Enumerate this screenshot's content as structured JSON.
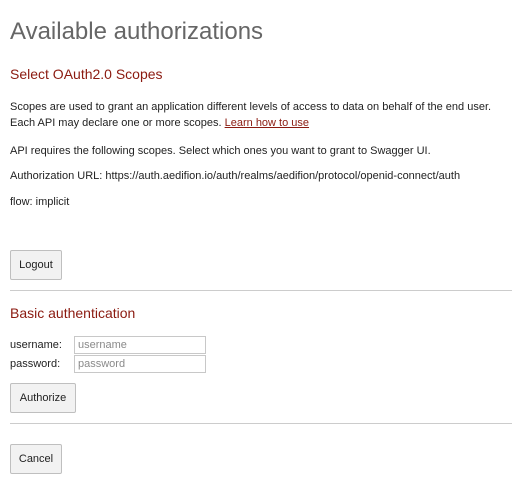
{
  "dialog": {
    "title": "Available authorizations",
    "oauth": {
      "heading": "Select OAuth2.0 Scopes",
      "description": "Scopes are used to grant an application different levels of access to data on behalf of the end user. Each API may declare one or more scopes.",
      "learn_link": "Learn how to use",
      "requires_text": "API requires the following scopes. Select which ones you want to grant to Swagger UI.",
      "auth_url_text": "Authorization URL: https://auth.aedifion.io/auth/realms/aedifion/protocol/openid-connect/auth",
      "flow_text": "flow: implicit",
      "logout_label": "Logout"
    },
    "basic": {
      "heading": "Basic authentication",
      "username_label": "username:",
      "username_placeholder": "username",
      "password_label": "password:",
      "password_placeholder": "password",
      "authorize_label": "Authorize"
    },
    "cancel_label": "Cancel"
  }
}
